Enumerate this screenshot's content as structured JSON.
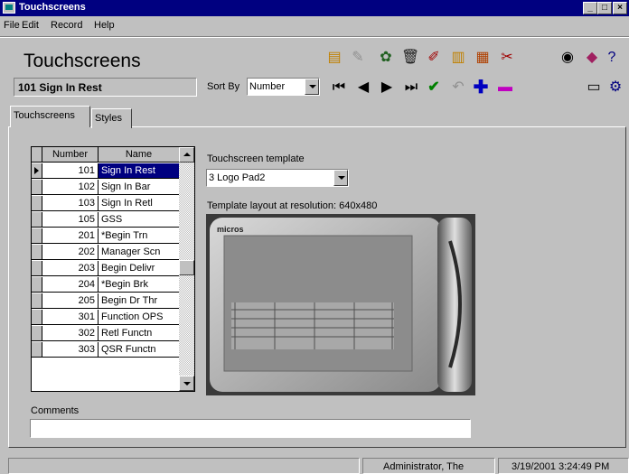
{
  "window": {
    "title": "Touchscreens"
  },
  "menu": {
    "file": "File",
    "edit": "Edit",
    "record": "Record",
    "help": "Help"
  },
  "header": {
    "title": "Touchscreens",
    "current_record": "101 Sign In Rest",
    "sort_by_label": "Sort By",
    "sort_by_value": "Number"
  },
  "tabs": [
    {
      "label": "Touchscreens"
    },
    {
      "label": "Styles"
    }
  ],
  "grid": {
    "columns": [
      "Number",
      "Name"
    ],
    "rows": [
      {
        "number": "101",
        "name": "Sign In Rest"
      },
      {
        "number": "102",
        "name": "Sign In Bar"
      },
      {
        "number": "103",
        "name": "Sign In Retl"
      },
      {
        "number": "105",
        "name": "GSS"
      },
      {
        "number": "201",
        "name": "*Begin Trn"
      },
      {
        "number": "202",
        "name": "Manager Scn"
      },
      {
        "number": "203",
        "name": "Begin Delivr"
      },
      {
        "number": "204",
        "name": "*Begin Brk"
      },
      {
        "number": "205",
        "name": "Begin Dr Thr"
      },
      {
        "number": "301",
        "name": "Function OPS"
      },
      {
        "number": "302",
        "name": "Retl Functn"
      },
      {
        "number": "303",
        "name": "QSR Functn"
      }
    ]
  },
  "template": {
    "label": "Touchscreen template",
    "value": "3 Logo Pad2",
    "layout_label": "Template layout at resolution: 640x480",
    "brand": "micros"
  },
  "comments": {
    "label": "Comments",
    "value": ""
  },
  "status": {
    "user": "Administrator, The",
    "datetime": "3/19/2001 3:24:49 PM"
  },
  "icons": [
    "copy-record-icon",
    "paste-record-icon",
    "record-group-icon",
    "delete-icon",
    "edit-icon",
    "copy-icon",
    "paste-icon",
    "cut-icon",
    "find-icon",
    "tag-icon",
    "help-pointer-icon",
    "first-record-icon",
    "prev-record-icon",
    "next-record-icon",
    "last-record-icon",
    "save-check-icon",
    "undo-icon",
    "add-record-icon",
    "remove-record-icon",
    "monitor-icon",
    "network-icon"
  ]
}
